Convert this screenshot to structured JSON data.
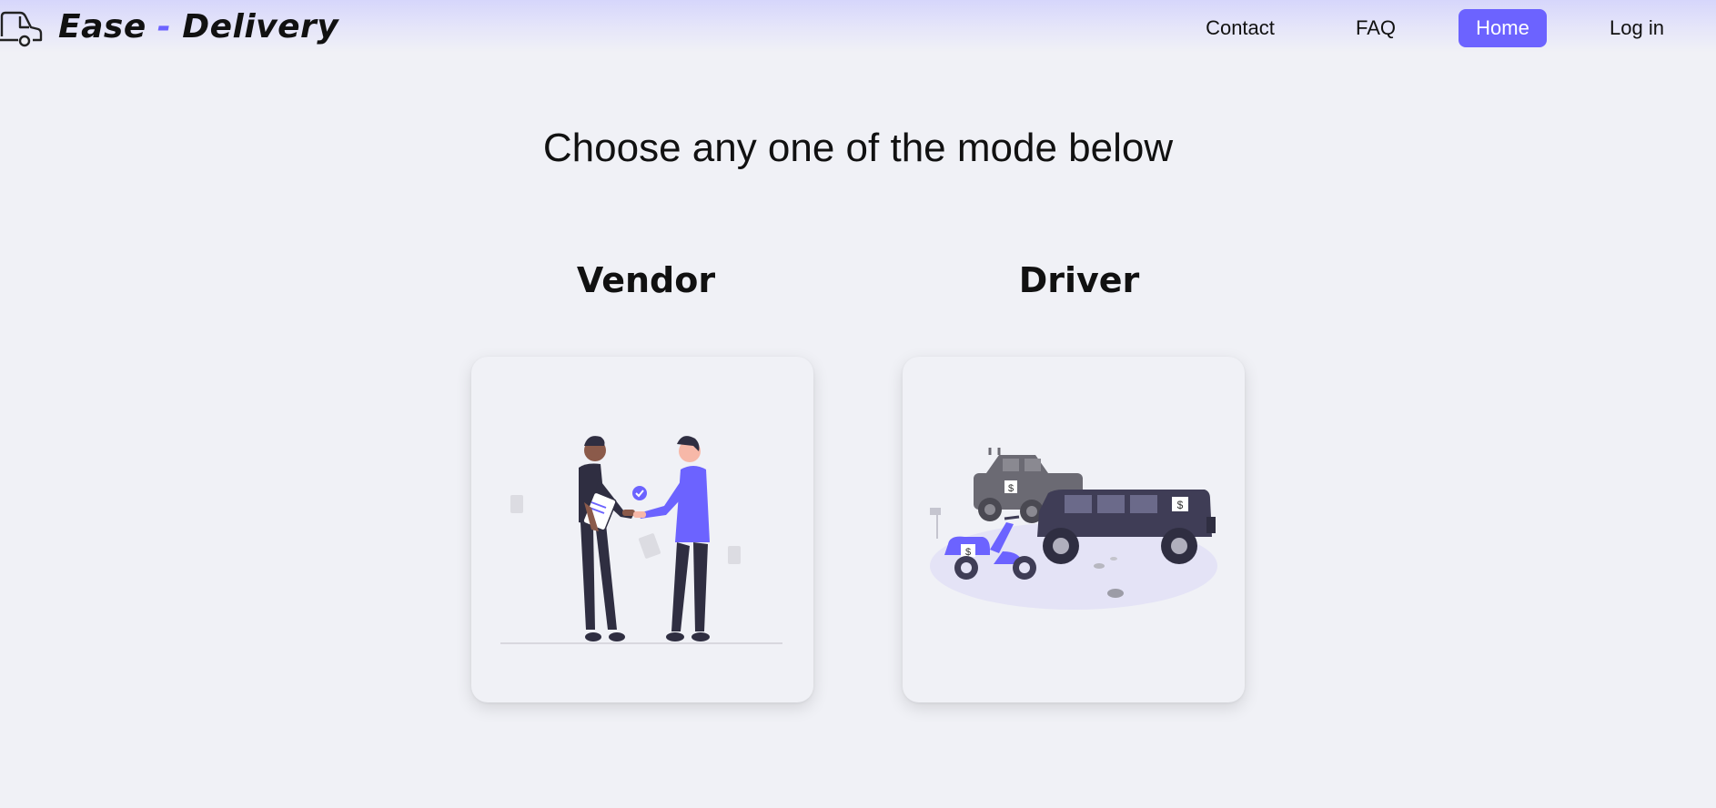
{
  "header": {
    "brand_name": "Ease",
    "brand_separator": "-",
    "brand_name_2": "Delivery",
    "nav": {
      "contact": "Contact",
      "faq": "FAQ",
      "home": "Home",
      "login": "Log in"
    },
    "active_nav": "home",
    "logo_icon": "delivery-van-icon"
  },
  "main": {
    "title": "Choose any one of the mode below",
    "modes": [
      {
        "label": "Vendor",
        "illustration": "handshake-illustration"
      },
      {
        "label": "Driver",
        "illustration": "vehicles-illustration"
      }
    ]
  },
  "colors": {
    "accent": "#6c63ff",
    "background": "#f0f1f6",
    "text": "#111111"
  },
  "card_labels": {
    "dollar_sign": "$"
  }
}
